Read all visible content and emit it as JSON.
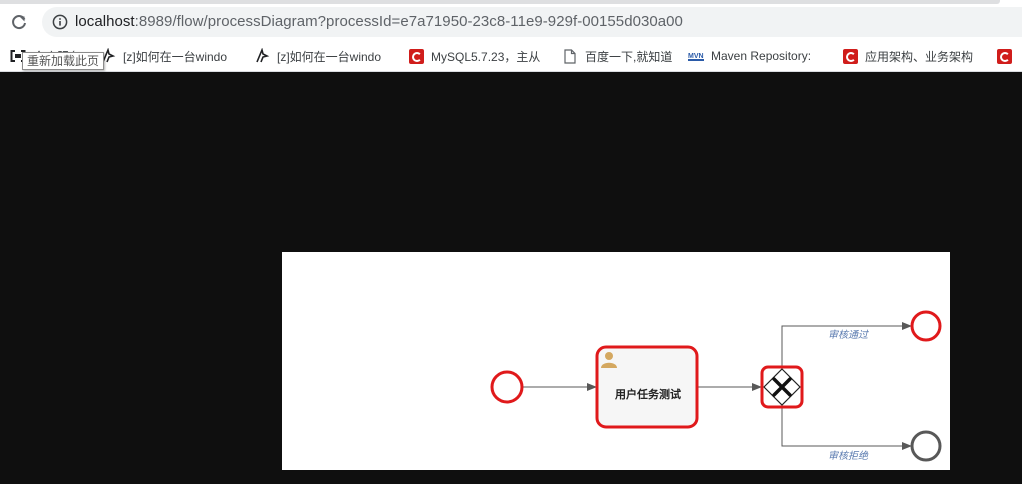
{
  "browser": {
    "url_host": "localhost",
    "url_rest": ":8989/flow/processDiagram?processId=e7a71950-23c8-11e9-929f-00155d030a00",
    "reload_tooltip": "重新加载此页"
  },
  "bookmarks": [
    {
      "label": "全库服务",
      "icon": "bracket-icon"
    },
    {
      "label": "[z]如何在一台windo",
      "icon": "z-logo-icon"
    },
    {
      "label": "[z]如何在一台windo",
      "icon": "z-logo-icon"
    },
    {
      "label": "MySQL5.7.23，主从",
      "icon": "csdn-c-icon"
    },
    {
      "label": "百度一下,就知道",
      "icon": "page-icon"
    },
    {
      "label": "Maven Repository:",
      "icon": "mvn-icon"
    },
    {
      "label": "应用架构、业务架构",
      "icon": "csdn-c-icon"
    },
    {
      "label": "",
      "icon": "csdn-c-icon"
    }
  ],
  "diagram": {
    "task_name": "用户任务测试",
    "flow_approve": "审核通过",
    "flow_reject": "审核拒绝",
    "colors": {
      "highlight": "#e0191b",
      "stroke": "#585858",
      "task_fill": "#f6f6f6",
      "label": "#5b7bb0",
      "user_icon": "#d4a860"
    }
  }
}
